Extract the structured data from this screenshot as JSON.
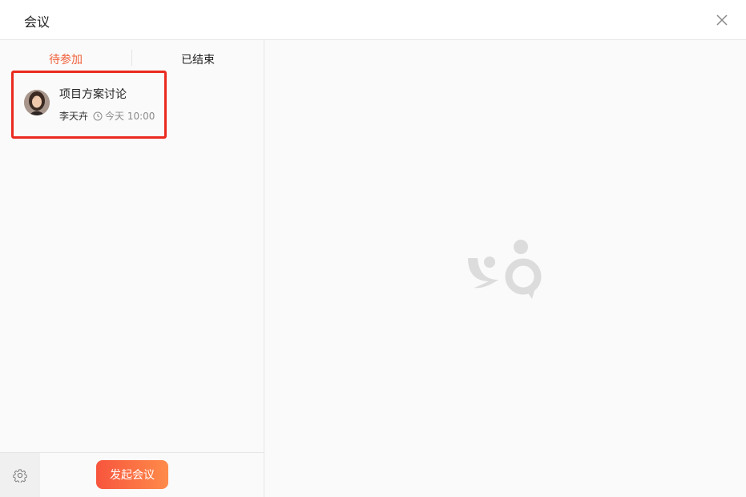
{
  "window": {
    "title": "会议"
  },
  "tabs": [
    {
      "label": "待参加",
      "active": true
    },
    {
      "label": "已结束",
      "active": false
    }
  ],
  "meetings": [
    {
      "title": "项目方案讨论",
      "host": "李天卉",
      "time": "今天 10:00"
    }
  ],
  "footer": {
    "start_meeting_label": "发起会议"
  },
  "icons": {
    "close": "close-icon",
    "clock": "clock-icon",
    "settings": "gear-icon",
    "empty_state": "meeting-logo-icon"
  },
  "colors": {
    "accent": "#f0613c",
    "highlight_border": "#ea2a1f",
    "button_start": "#f7553d",
    "button_end": "#ff8b4a"
  }
}
